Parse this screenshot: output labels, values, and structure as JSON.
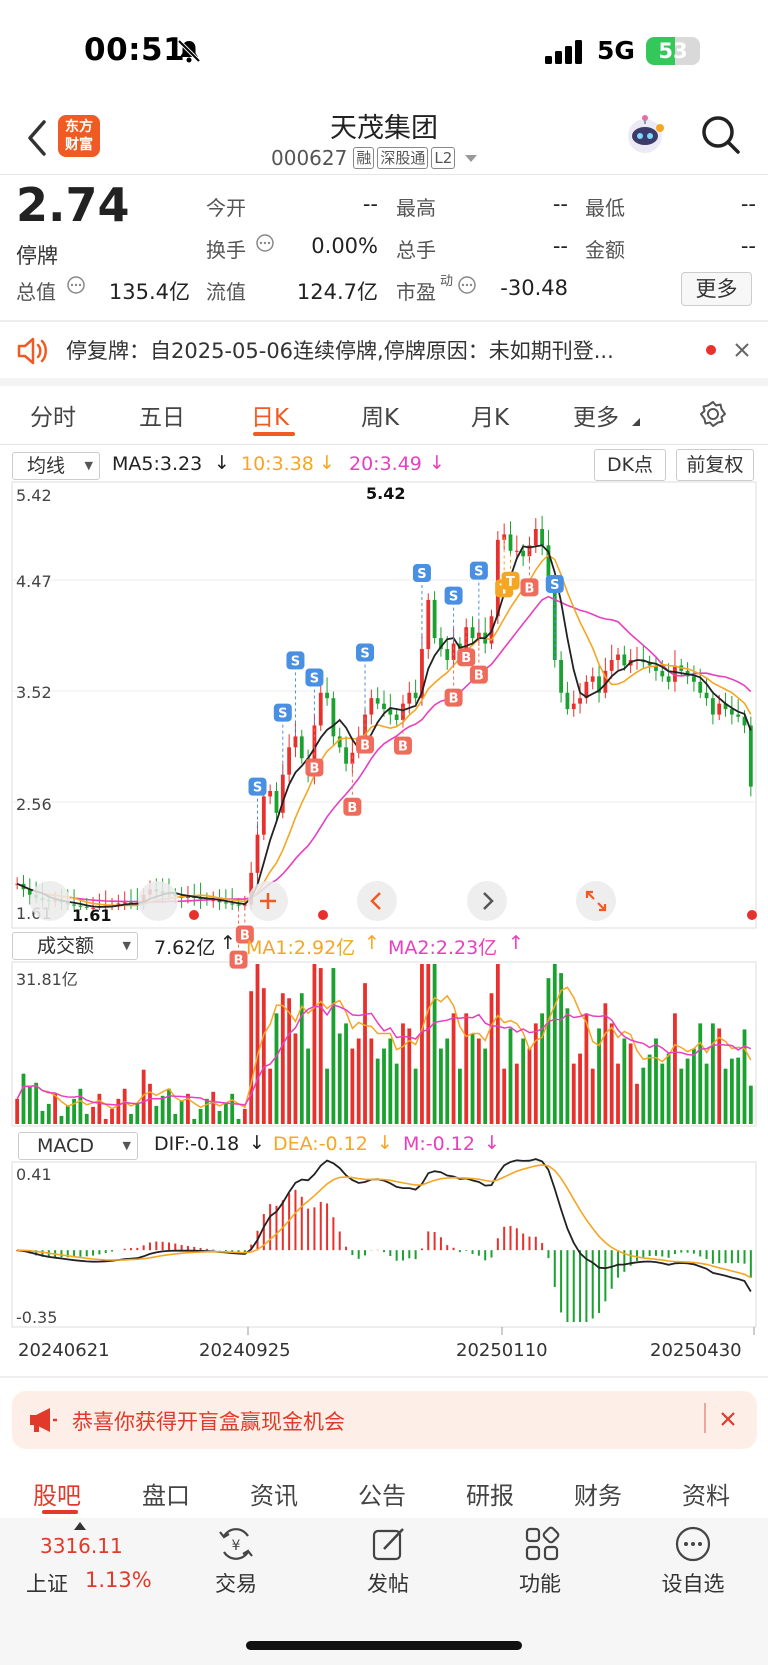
{
  "status_bar": {
    "time": "00:51",
    "network": "5G",
    "battery": "53",
    "battery_level": 0.53
  },
  "header": {
    "logo_text": "东方财富",
    "stock_name": "天茂集团",
    "stock_code": "000627",
    "tags": [
      "融",
      "深股通",
      "L2"
    ]
  },
  "quote": {
    "price": "2.74",
    "status": "停牌",
    "open_label": "今开",
    "open_value": "--",
    "high_label": "最高",
    "high_value": "--",
    "low_label": "最低",
    "low_value": "--",
    "turnover_label": "换手",
    "turnover_value": "0.00%",
    "volume_label": "总手",
    "volume_value": "--",
    "amount_label": "金额",
    "amount_value": "--",
    "mktcap_label": "总值",
    "mktcap_value": "135.4亿",
    "float_label": "流值",
    "float_value": "124.7亿",
    "pe_label": "市盈",
    "pe_super": "动",
    "pe_value": "-30.48",
    "more_button": "更多"
  },
  "notice": {
    "text": "停复牌：自2025-05-06连续停牌,停牌原因：未如期刊登..."
  },
  "period_tabs": [
    "分时",
    "五日",
    "日K",
    "周K",
    "月K",
    "更多"
  ],
  "chart_controls": {
    "ma_select": "均线",
    "dk_button": "DK点",
    "adjust_button": "前复权",
    "vol_select": "成交额",
    "macd_select": "MACD"
  },
  "chart_data": [
    {
      "type": "candlestick",
      "title": "日K",
      "legend": [
        {
          "name": "MA5",
          "value": "MA5:3.23",
          "color": "#222222"
        },
        {
          "name": "10",
          "value": "10:3.38",
          "color": "#f5a623"
        },
        {
          "name": "20",
          "value": "20:3.49",
          "color": "#e83fbf"
        }
      ],
      "y_ticks": [
        "5.42",
        "4.47",
        "3.52",
        "2.56",
        "1.61"
      ],
      "ylim": [
        1.61,
        5.42
      ],
      "max_marker": "5.42",
      "min_marker": "1.61",
      "x_ticks": [
        "20240621",
        "20240925",
        "20250110",
        "20250430"
      ],
      "close_series": [
        1.85,
        1.8,
        1.75,
        1.72,
        1.7,
        1.69,
        1.7,
        1.68,
        1.66,
        1.65,
        1.64,
        1.63,
        1.63,
        1.64,
        1.65,
        1.66,
        1.67,
        1.68,
        1.67,
        1.66,
        1.75,
        1.8,
        1.78,
        1.76,
        1.75,
        1.74,
        1.72,
        1.73,
        1.72,
        1.71,
        1.7,
        1.7,
        1.68,
        1.67,
        1.66,
        1.65,
        1.66,
        1.95,
        2.3,
        2.65,
        2.7,
        2.5,
        2.85,
        3.1,
        3.2,
        3.0,
        2.85,
        3.3,
        3.6,
        3.55,
        3.2,
        3.1,
        2.95,
        3.05,
        3.15,
        3.4,
        3.55,
        3.5,
        3.45,
        3.4,
        3.35,
        3.5,
        3.6,
        3.55,
        4.0,
        4.45,
        4.1,
        4.0,
        3.9,
        4.05,
        4.0,
        4.2,
        4.1,
        4.15,
        4.05,
        4.3,
        5.0,
        5.05,
        4.9,
        4.9,
        4.85,
        4.95,
        5.1,
        4.95,
        4.6,
        3.9,
        3.6,
        3.45,
        3.5,
        3.55,
        3.7,
        3.75,
        3.6,
        3.8,
        3.9,
        3.95,
        3.85,
        3.9,
        3.9,
        3.88,
        3.85,
        3.8,
        3.75,
        3.7,
        3.85,
        3.8,
        3.75,
        3.7,
        3.6,
        3.55,
        3.4,
        3.5,
        3.45,
        3.4,
        3.38,
        3.3,
        2.74
      ],
      "markers": [
        "S",
        "S",
        "S",
        "S",
        "S",
        "S",
        "S",
        "S",
        "B",
        "B",
        "B",
        "B",
        "B",
        "B",
        "B",
        "B",
        "B",
        "T",
        "T",
        "B",
        "S"
      ]
    },
    {
      "type": "bar",
      "title": "成交额",
      "legend": [
        {
          "name": "成交额",
          "value": "7.62亿",
          "color": "#222222"
        },
        {
          "name": "MA1",
          "value": "MA1:2.92亿",
          "color": "#f5a623"
        },
        {
          "name": "MA2",
          "value": "MA2:2.23亿",
          "color": "#e83fbf"
        }
      ],
      "y_max_label": "31.81亿",
      "ylim": [
        0,
        31.81
      ]
    },
    {
      "type": "bar",
      "title": "MACD",
      "legend": [
        {
          "name": "DIF",
          "value": "DIF:-0.18",
          "color": "#222222"
        },
        {
          "name": "DEA",
          "value": "DEA:-0.12",
          "color": "#f5a623"
        },
        {
          "name": "M",
          "value": "M:-0.12",
          "color": "#e83fbf"
        }
      ],
      "y_ticks": [
        "0.41",
        "-0.35"
      ],
      "ylim": [
        -0.35,
        0.41
      ]
    }
  ],
  "promo": {
    "text": "恭喜你获得开盲盒赢现金机会"
  },
  "bottom_tabs": [
    "股吧",
    "盘口",
    "资讯",
    "公告",
    "研报",
    "财务",
    "资料"
  ],
  "bottom_nav": {
    "index_value": "3316.11",
    "index_name": "上证",
    "index_change": "1.13%",
    "items": [
      "交易",
      "发帖",
      "功能",
      "设自选"
    ]
  },
  "colors": {
    "up": "#e8302c",
    "down": "#1aa12f",
    "accent": "#f15a22"
  }
}
